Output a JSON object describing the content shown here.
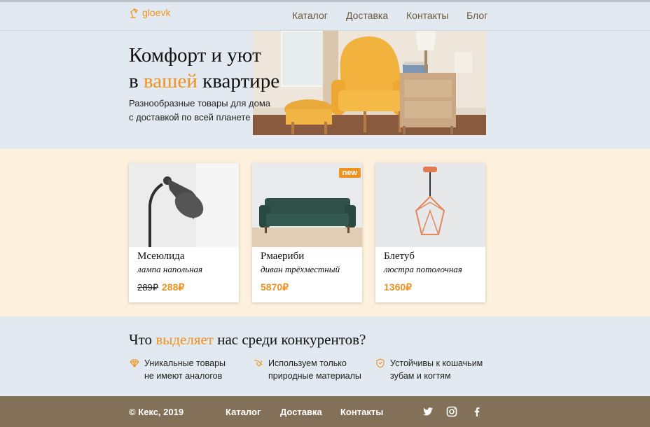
{
  "header": {
    "logo_text": "gloevk",
    "nav": [
      "Каталог",
      "Доставка",
      "Контакты",
      "Блог"
    ]
  },
  "hero": {
    "title_line1": "Комфорт и уют",
    "title_line2_prefix": "в",
    "title_line2_accent": "вашей",
    "title_line2_suffix": "квартире",
    "subtitle_line1": "Разнообразные товары для дома",
    "subtitle_line2": "с доставкой по всей планете"
  },
  "products": [
    {
      "name": "Мсеюлида",
      "type": "лампа напольная",
      "old_price": "289₽",
      "price": "288₽",
      "badge": ""
    },
    {
      "name": "Рмаериби",
      "type": "диван трёхместный",
      "old_price": "",
      "price": "5870₽",
      "badge": "new"
    },
    {
      "name": "Блетуб",
      "type": "люстра потолочная",
      "old_price": "",
      "price": "1360₽",
      "badge": ""
    }
  ],
  "features": {
    "title_prefix": "Что",
    "title_accent": "выделяет",
    "title_suffix": "нас среди конкурентов?",
    "items": [
      {
        "icon": "diamond-icon",
        "line1": "Уникальные товары",
        "line2": "не имеют аналогов"
      },
      {
        "icon": "leaf-icon",
        "line1": "Используем только",
        "line2": "природные материалы"
      },
      {
        "icon": "shield-icon",
        "line1": "Устойчивы к кошачьим",
        "line2": "зубам и когтям"
      }
    ]
  },
  "footer": {
    "copyright": "© Кекс, 2019",
    "links": [
      "Каталог",
      "Доставка",
      "Контакты"
    ],
    "social": [
      "twitter-icon",
      "instagram-icon",
      "facebook-icon"
    ]
  },
  "colors": {
    "accent": "#f0921f",
    "background": "#e2e9f0",
    "products_band": "#fdf0dd",
    "footer": "#827059",
    "nav_text": "#6e5a3c"
  }
}
